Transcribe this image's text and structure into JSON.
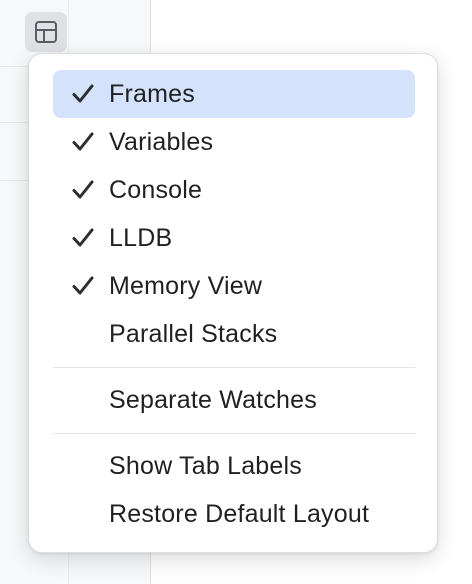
{
  "layout_button": {
    "icon": "layout-panel-icon"
  },
  "menu": {
    "groups": [
      {
        "items": [
          {
            "label": "Frames",
            "checked": true,
            "selected": true
          },
          {
            "label": "Variables",
            "checked": true,
            "selected": false
          },
          {
            "label": "Console",
            "checked": true,
            "selected": false
          },
          {
            "label": "LLDB",
            "checked": true,
            "selected": false
          },
          {
            "label": "Memory View",
            "checked": true,
            "selected": false
          },
          {
            "label": "Parallel Stacks",
            "checked": false,
            "selected": false
          }
        ]
      },
      {
        "items": [
          {
            "label": "Separate Watches",
            "checked": false,
            "selected": false
          }
        ]
      },
      {
        "items": [
          {
            "label": "Show Tab Labels",
            "checked": false,
            "selected": false
          },
          {
            "label": "Restore Default Layout",
            "checked": false,
            "selected": false
          }
        ]
      }
    ]
  },
  "colors": {
    "selection": "#d4e2fb",
    "text": "#1f2023",
    "check": "#2b2d30"
  }
}
